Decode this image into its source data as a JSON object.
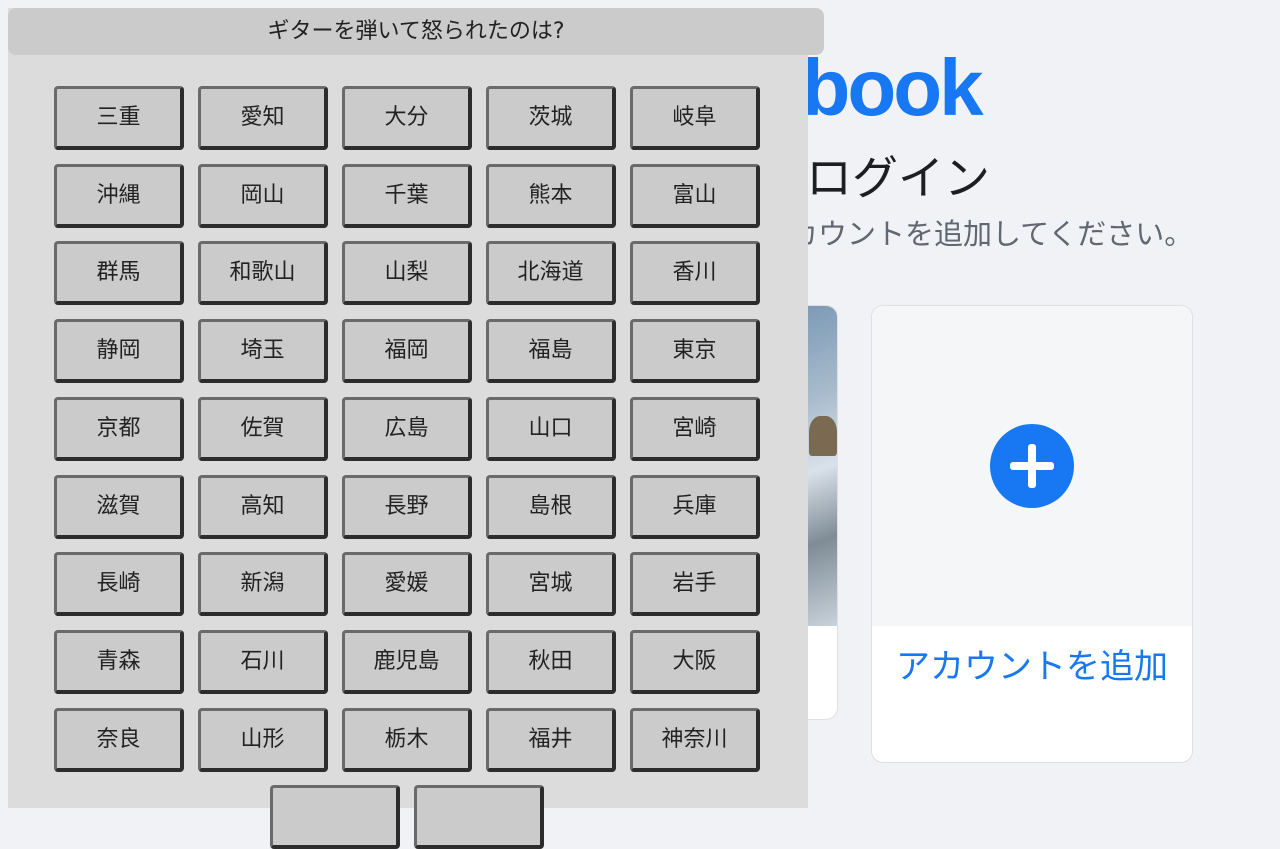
{
  "background": {
    "logo_text": "ebook",
    "heading": "りログイン",
    "subheading": "アカウントを追加してください。",
    "add_account_label": "アカウントを追加"
  },
  "quiz": {
    "question": "ギターを弾いて怒られたのは?",
    "options": [
      "三重",
      "愛知",
      "大分",
      "茨城",
      "岐阜",
      "沖縄",
      "岡山",
      "千葉",
      "熊本",
      "富山",
      "群馬",
      "和歌山",
      "山梨",
      "北海道",
      "香川",
      "静岡",
      "埼玉",
      "福岡",
      "福島",
      "東京",
      "京都",
      "佐賀",
      "広島",
      "山口",
      "宮崎",
      "滋賀",
      "高知",
      "長野",
      "島根",
      "兵庫",
      "長崎",
      "新潟",
      "愛媛",
      "宮城",
      "岩手",
      "青森",
      "石川",
      "鹿児島",
      "秋田",
      "大阪",
      "奈良",
      "山形",
      "栃木",
      "福井",
      "神奈川",
      "",
      ""
    ]
  },
  "colors": {
    "brand": "#1877f2",
    "panel_bg": "#dcdcdc",
    "button_bg": "#cbcbcb"
  }
}
